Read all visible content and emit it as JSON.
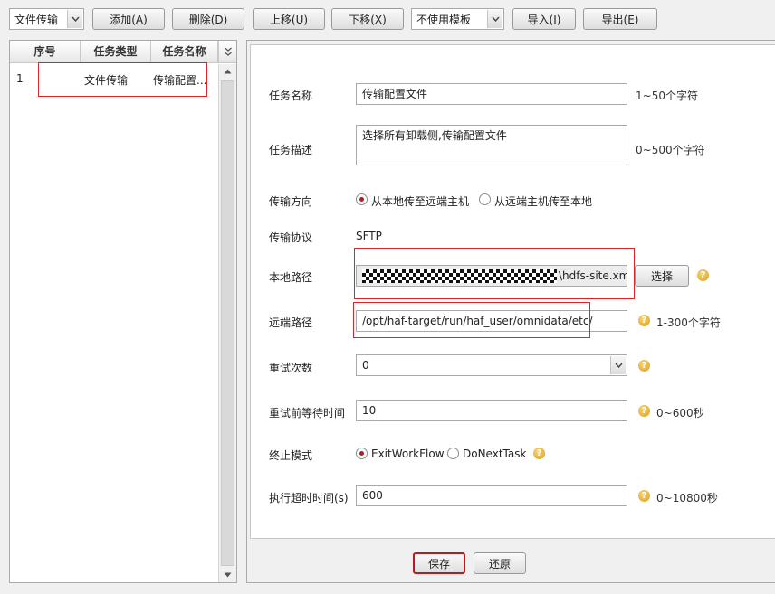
{
  "toolbar": {
    "type_select_value": "文件传输",
    "add_label": "添加(A)",
    "delete_label": "删除(D)",
    "move_up_label": "上移(U)",
    "move_down_label": "下移(X)",
    "template_select_value": "不使用模板",
    "import_label": "导入(I)",
    "export_label": "导出(E)"
  },
  "task_list": {
    "columns": [
      "序号",
      "任务类型",
      "任务名称"
    ],
    "rows": [
      {
        "index": "1",
        "type": "文件传输",
        "name": "传输配置..."
      }
    ]
  },
  "form": {
    "task_name": {
      "label": "任务名称",
      "value": "传输配置文件",
      "hint": "1~50个字符"
    },
    "task_desc": {
      "label": "任务描述",
      "value": "选择所有卸载侧,传输配置文件",
      "hint": "0~500个字符"
    },
    "direction": {
      "label": "传输方向",
      "options": [
        "从本地传至远端主机",
        "从远端主机传至本地"
      ],
      "selected": "从本地传至远端主机"
    },
    "protocol": {
      "label": "传输协议",
      "value": "SFTP"
    },
    "local_path": {
      "label": "本地路径",
      "value_suffix": "\\hdfs-site.xml",
      "choose_label": "选择"
    },
    "remote_path": {
      "label": "远端路径",
      "value": "/opt/haf-target/run/haf_user/omnidata/etc/",
      "hint": "1-300个字符"
    },
    "retry_count": {
      "label": "重试次数",
      "value": "0"
    },
    "retry_wait": {
      "label": "重试前等待时间",
      "value": "10",
      "hint": "0~600秒"
    },
    "stop_mode": {
      "label": "终止模式",
      "options": [
        "ExitWorkFlow",
        "DoNextTask"
      ],
      "selected": "ExitWorkFlow"
    },
    "timeout": {
      "label": "执行超时时间(s)",
      "value": "600",
      "hint": "0~10800秒"
    }
  },
  "actions": {
    "save_label": "保存",
    "restore_label": "还原"
  },
  "icons": {
    "help": "help-icon",
    "dropdown": "chevron-down-icon"
  },
  "colors": {
    "highlight_border": "#d9262c",
    "radio_selected": "#c0161c",
    "help_icon": "#e0aa2a"
  }
}
